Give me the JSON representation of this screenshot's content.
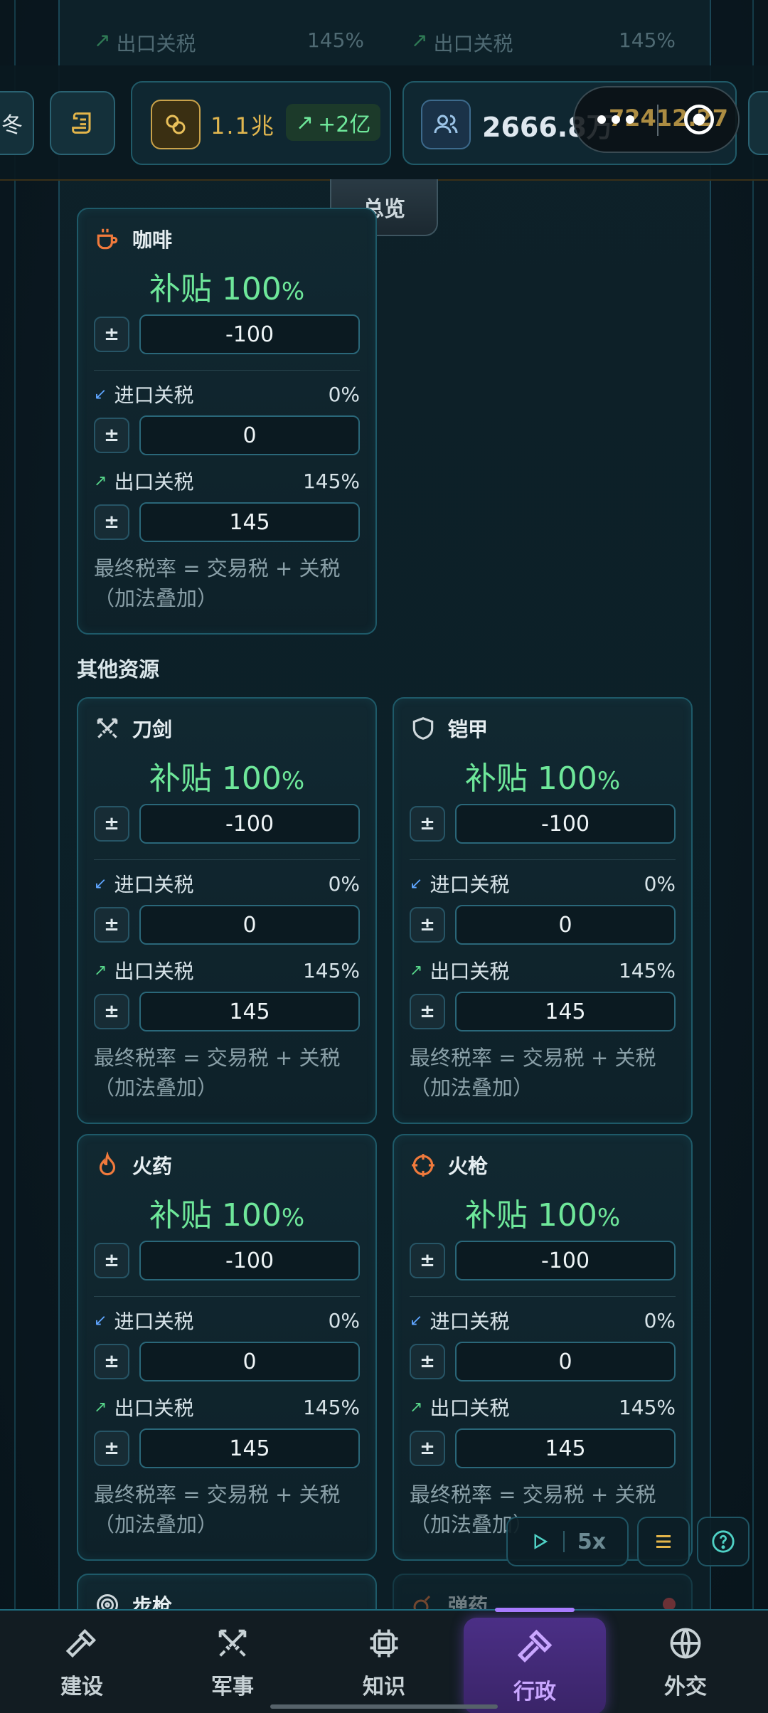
{
  "top_ghost": {
    "export_label_left": "出口关税",
    "export_value_left": "145%",
    "export_label_right": "出口关税",
    "export_value_right": "145%"
  },
  "topbar": {
    "season": "冬",
    "gold_amount": "1.1兆",
    "gold_change": "+2亿",
    "population": "2666.8万",
    "overlay_number": "72412.27"
  },
  "overview_tab": "总览",
  "section_title": "其他资源",
  "cards": [
    {
      "name": "咖啡",
      "subsidy_prefix": "补贴 100",
      "subsidy_pct": "%",
      "field": "-100",
      "import_label": "进口关税",
      "import_pct": "0%",
      "import_field": "0",
      "export_label": "出口关税",
      "export_pct": "145%",
      "export_field": "145",
      "note_line1": "最终税率 = 交易税 + 关税",
      "note_line2": "（加法叠加）",
      "icon": "coffee-icon",
      "icon_color": "#f07a3c"
    },
    {
      "name": "刀剑",
      "subsidy_prefix": "补贴 100",
      "subsidy_pct": "%",
      "field": "-100",
      "import_label": "进口关税",
      "import_pct": "0%",
      "import_field": "0",
      "export_label": "出口关税",
      "export_pct": "145%",
      "export_field": "145",
      "note_line1": "最终税率 = 交易税 + 关税",
      "note_line2": "（加法叠加）",
      "icon": "swords-icon",
      "icon_color": "#cfd8dc"
    },
    {
      "name": "铠甲",
      "subsidy_prefix": "补贴 100",
      "subsidy_pct": "%",
      "field": "-100",
      "import_label": "进口关税",
      "import_pct": "0%",
      "import_field": "0",
      "export_label": "出口关税",
      "export_pct": "145%",
      "export_field": "145",
      "note_line1": "最终税率 = 交易税 + 关税",
      "note_line2": "（加法叠加）",
      "icon": "shield-icon",
      "icon_color": "#cfd8dc"
    },
    {
      "name": "火药",
      "subsidy_prefix": "补贴 100",
      "subsidy_pct": "%",
      "field": "-100",
      "import_label": "进口关税",
      "import_pct": "0%",
      "import_field": "0",
      "export_label": "出口关税",
      "export_pct": "145%",
      "export_field": "145",
      "note_line1": "最终税率 = 交易税 + 关税",
      "note_line2": "（加法叠加）",
      "icon": "flame-icon",
      "icon_color": "#f07a3c"
    },
    {
      "name": "火枪",
      "subsidy_prefix": "补贴 100",
      "subsidy_pct": "%",
      "field": "-100",
      "import_label": "进口关税",
      "import_pct": "0%",
      "import_field": "0",
      "export_label": "出口关税",
      "export_pct": "145%",
      "export_field": "145",
      "note_line1": "最终税率 = 交易税 + 关税",
      "note_line2": "（加法叠加）",
      "icon": "crosshair-icon",
      "icon_color": "#f07a3c"
    }
  ],
  "partial_cards": {
    "left": "步枪",
    "right": "弹药"
  },
  "controls": {
    "speed": "5x"
  },
  "nav": [
    {
      "label": "建设",
      "icon": "hammer-icon"
    },
    {
      "label": "军事",
      "icon": "swords-icon"
    },
    {
      "label": "知识",
      "icon": "chip-icon"
    },
    {
      "label": "行政",
      "icon": "gavel-icon",
      "active": true
    },
    {
      "label": "外交",
      "icon": "globe-icon"
    }
  ],
  "colors": {
    "accent": "#6ee79a",
    "nav_active": "#4b2f86",
    "import_arrow": "#5fa5ff",
    "export_arrow": "#57d68a"
  }
}
